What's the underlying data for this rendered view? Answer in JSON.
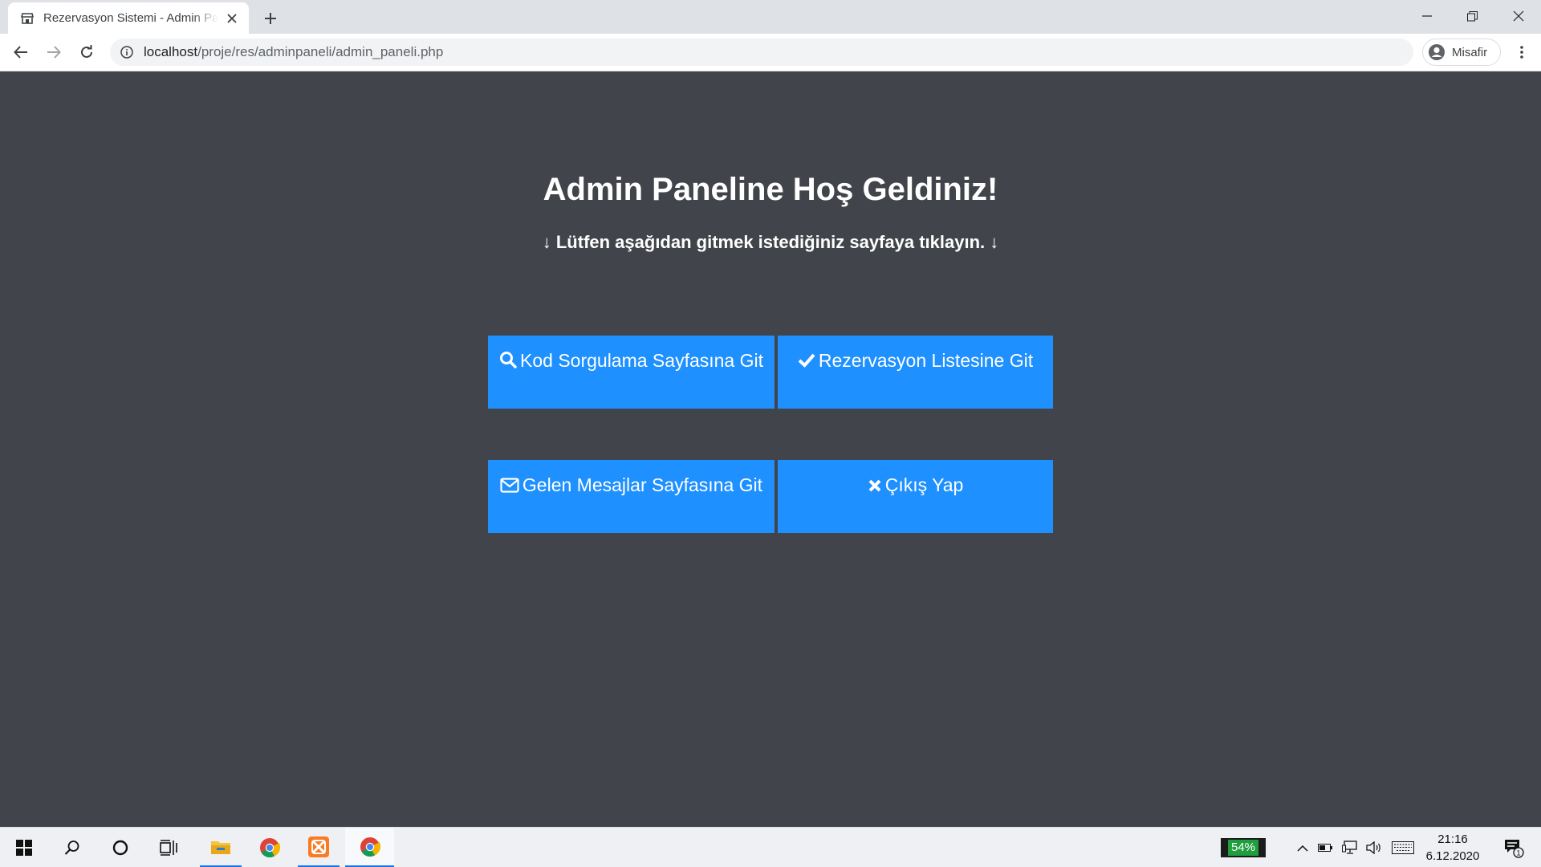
{
  "browser": {
    "tab_title": "Rezervasyon Sistemi - Admin Paneli",
    "url_host": "localhost",
    "url_path": "/proje/res/adminpaneli/admin_paneli.php",
    "profile_label": "Misafir"
  },
  "page": {
    "title": "Admin Paneline Hoş Geldiniz!",
    "subtitle": "↓ Lütfen aşağıdan gitmek istediğiniz sayfaya tıklayın. ↓",
    "buttons": [
      {
        "label": "Kod Sorgulama Sayfasına Git",
        "icon": "search-icon"
      },
      {
        "label": "Rezervasyon Listesine Git",
        "icon": "check-icon"
      },
      {
        "label": "Gelen Mesajlar Sayfasına Git",
        "icon": "envelope-icon"
      },
      {
        "label": "Çıkış Yap",
        "icon": "times-icon"
      }
    ],
    "colors": {
      "background": "#42444b",
      "button": "#1e90ff",
      "text": "#ffffff"
    }
  },
  "taskbar": {
    "battery": "54%",
    "time": "21:16",
    "date": "6.12.2020",
    "notification_count": "1"
  }
}
